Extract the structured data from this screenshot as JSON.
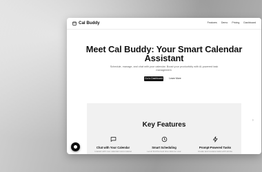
{
  "nav": {
    "brand": "Cal Buddy",
    "links": [
      "Features",
      "Demo",
      "Pricing",
      "Dashboard"
    ]
  },
  "hero": {
    "title_line1": "Meet Cal Buddy: Your Smart Calendar",
    "title_line2": "Assistant",
    "subtitle": "Schedule, manage, and chat with your calendar. Boost your productivity with AI-powered task management.",
    "primary_button": "Go to Dashboard",
    "secondary_button": "Learn More"
  },
  "features": {
    "title": "Key Features",
    "items": [
      {
        "icon": "chat-icon",
        "title": "Chat with Your Calendar",
        "desc": "Interact with your calendar using natural"
      },
      {
        "icon": "clock-icon",
        "title": "Smart Scheduling",
        "desc": "Let AI find the best time slots for your"
      },
      {
        "icon": "lightning-icon",
        "title": "Prompt-Powered Tasks",
        "desc": "Create and manage tasks with simple"
      }
    ]
  },
  "colors": {
    "accent": "#111111",
    "feature_bg": "#f1f1f1"
  }
}
